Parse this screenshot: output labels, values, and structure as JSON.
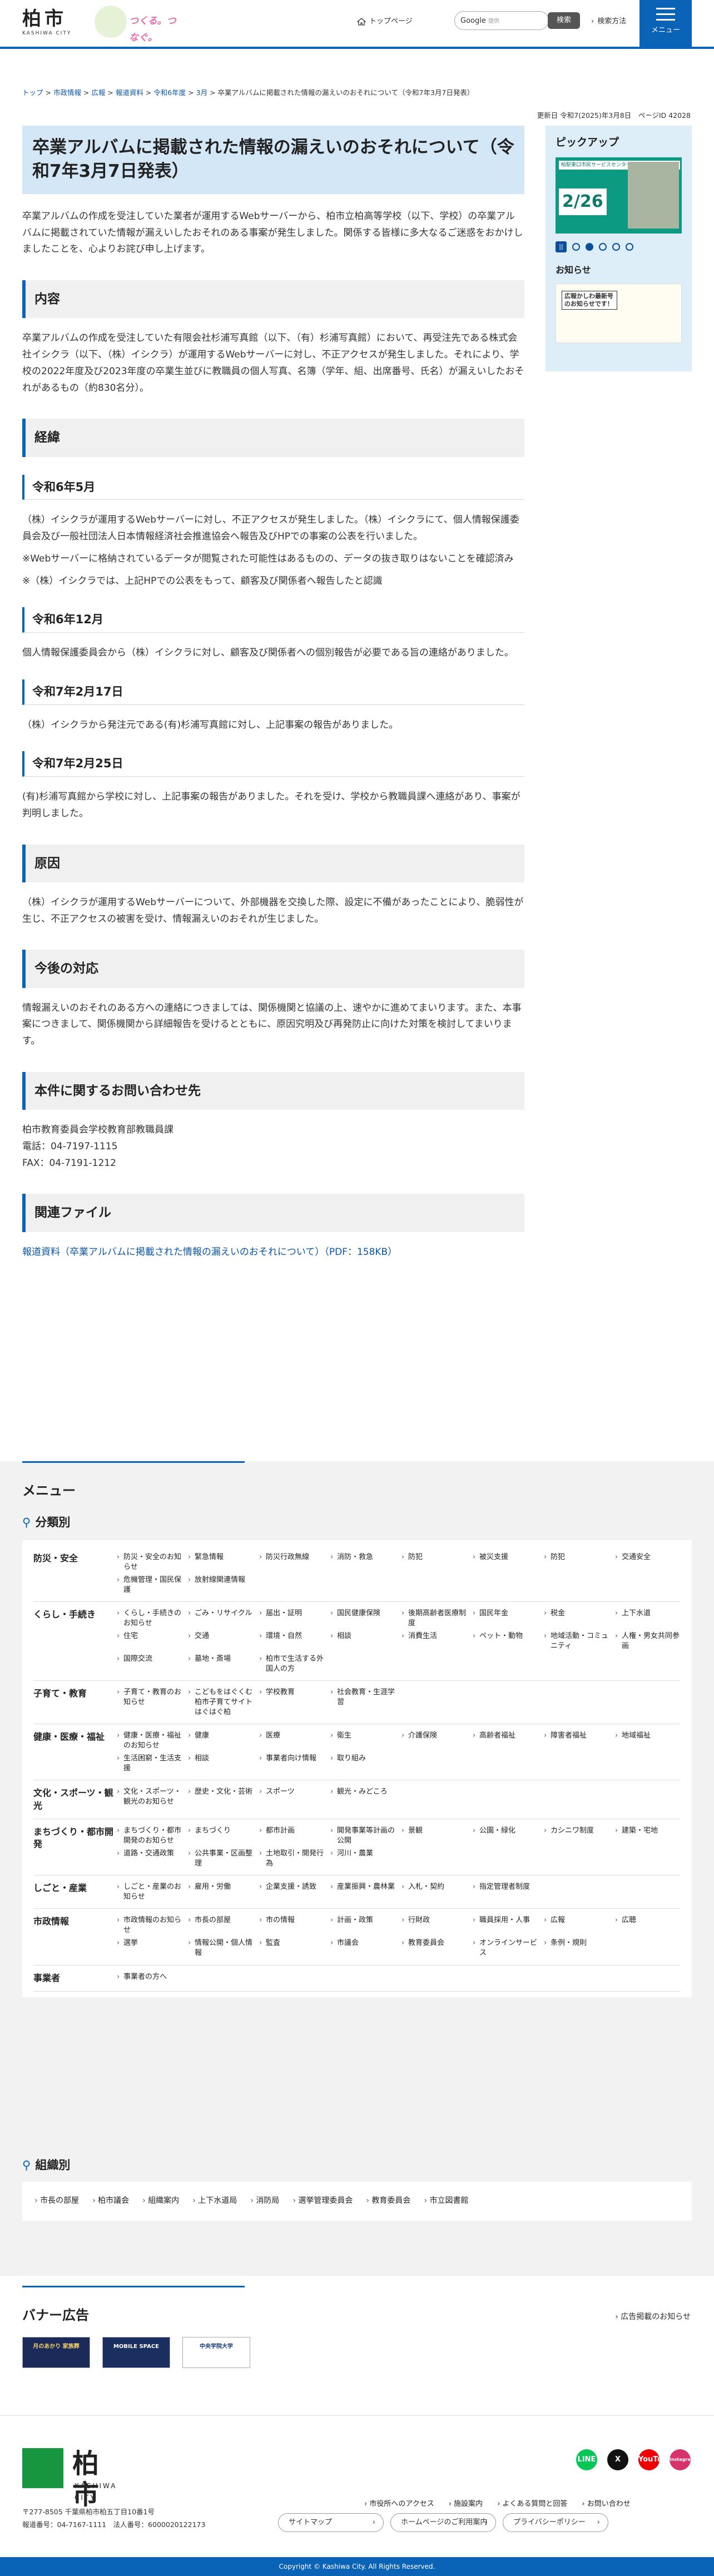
{
  "header": {
    "logo_jp": "柏市",
    "logo_en": "KASHIWA CITY",
    "mascot_tag": "つくる。つなぐ。",
    "top_page": "トップページ",
    "search_brand": "Google",
    "search_placeholder": "提供",
    "search_button": "検索",
    "search_method": "検索方法",
    "menu": "メニュー"
  },
  "breadcrumb": [
    "トップ",
    "市政情報",
    "広報",
    "報道資料",
    "令和6年度",
    "3月",
    "卒業アルバムに掲載された情報の漏えいのおそれについて（令和7年3月7日発表）"
  ],
  "meta": {
    "updated": "更新日 令和7(2025)年3月8日",
    "page_id": "ページID 42028"
  },
  "main": {
    "title": "卒業アルバムに掲載された情報の漏えいのおそれについて（令和7年3月7日発表）",
    "lead": "卒業アルバムの作成を受注していた業者が運用するWebサーバーから、柏市立柏高等学校（以下、学校）の卒業アルバムに掲載されていた情報が漏えいしたおそれのある事案が発生しました。関係する皆様に多大なるご迷惑をおかけしましたことを、心よりお詫び申し上げます。",
    "h_content": "内容",
    "content": "卒業アルバムの作成を受注していた有限会社杉浦写真館（以下、（有）杉浦写真館）において、再受注先である株式会社イシクラ（以下、（株）イシクラ）が運用するWebサーバーに対し、不正アクセスが発生しました。それにより、学校の2022年度及び2023年度の卒業生並びに教職員の個人写真、名簿（学年、組、出席番号、氏名）が漏えいしたおそれがあるもの（約830名分）。",
    "h_history": "経緯",
    "h_may": "令和6年5月",
    "may_p1": "（株）イシクラが運用するWebサーバーに対し、不正アクセスが発生しました。（株）イシクラにて、個人情報保護委員会及び一般社団法人日本情報経済社会推進協会へ報告及びHPでの事案の公表を行いました。",
    "may_p2": "※Webサーバーに格納されているデータが閲覧された可能性はあるものの、データの抜き取りはないことを確認済み",
    "may_p3": "※（株）イシクラでは、上記HPでの公表をもって、顧客及び関係者へ報告したと認識",
    "h_dec": "令和6年12月",
    "dec_p": "個人情報保護委員会から（株）イシクラに対し、顧客及び関係者への個別報告が必要である旨の連絡がありました。",
    "h_feb17": "令和7年2月17日",
    "feb17_p": "（株）イシクラから発注元である(有)杉浦写真館に対し、上記事案の報告がありました。",
    "h_feb25": "令和7年2月25日",
    "feb25_p": "(有)杉浦写真館から学校に対し、上記事案の報告がありました。それを受け、学校から教職員課へ連絡があり、事案が判明しました。",
    "h_cause": "原因",
    "cause_p": "（株）イシクラが運用するWebサーバーについて、外部機器を交換した際、設定に不備があったことにより、脆弱性が生じ、不正アクセスの被害を受け、情報漏えいのおそれが生じました。",
    "h_future": "今後の対応",
    "future_p": "情報漏えいのおそれのある方への連絡につきましては、関係機関と協議の上、速やかに進めてまいります。また、本事案につきまして、関係機関から詳細報告を受けるとともに、原因究明及び再発防止に向けた対策を検討してまいります。",
    "h_contact": "本件に関するお問い合わせ先",
    "contact_org": "柏市教育委員会学校教育部教職員課",
    "contact_tel": "電話：04-7197-1115",
    "contact_fax": "FAX：04-7191-1212",
    "h_files": "関連ファイル",
    "file_link": "報道資料（卒業アルバムに掲載された情報の漏えいのおそれについて）（PDF：158KB）"
  },
  "sidebar": {
    "pickup": "ピックアップ",
    "banner_text": "柏駅東口市民サービスセンター 臨時バス停センター",
    "banner_date": "2/26",
    "notice": "お知らせ",
    "notice_banner": "広報かしわ最新号のお知らせです！"
  },
  "menu": {
    "title": "メニュー",
    "by_category": "分類別",
    "categories": [
      {
        "head": "防災・安全",
        "items": [
          "防災・安全のお知らせ",
          "緊急情報",
          "防災行政無線",
          "消防・救急",
          "防犯",
          "被災支援",
          "防犯",
          "交通安全",
          "危機管理・国民保護",
          "放射線関連情報"
        ]
      },
      {
        "head": "くらし・手続き",
        "items": [
          "くらし・手続きのお知らせ",
          "ごみ・リサイクル",
          "届出・証明",
          "国民健康保険",
          "後期高齢者医療制度",
          "国民年金",
          "税金",
          "上下水道",
          "住宅",
          "交通",
          "環境・自然",
          "相談",
          "消費生活",
          "ペット・動物",
          "地域活動・コミュニティ",
          "人権・男女共同参画",
          "国際交流",
          "墓地・斎場",
          "柏市で生活する外国人の方"
        ]
      },
      {
        "head": "子育て・教育",
        "items": [
          "子育て・教育のお知らせ",
          "こどもをはぐくむ柏市子育てサイト　はぐはぐ柏",
          "学校教育",
          "社会教育・生涯学習"
        ]
      },
      {
        "head": "健康・医療・福祉",
        "items": [
          "健康・医療・福祉のお知らせ",
          "健康",
          "医療",
          "衛生",
          "介護保険",
          "高齢者福祉",
          "障害者福祉",
          "地域福祉",
          "生活困窮・生活支援",
          "相談",
          "事業者向け情報",
          "取り組み"
        ]
      },
      {
        "head": "文化・スポーツ・観光",
        "items": [
          "文化・スポーツ・観光のお知らせ",
          "歴史・文化・芸術",
          "スポーツ",
          "観光・みどころ"
        ]
      },
      {
        "head": "まちづくり・都市開発",
        "items": [
          "まちづくり・都市開発のお知らせ",
          "まちづくり",
          "都市計画",
          "開発事業等計画の公開",
          "景観",
          "公園・緑化",
          "カシニワ制度",
          "建築・宅地",
          "道路・交通政策",
          "公共事業・区画整理",
          "土地取引・開発行為",
          "河川・農業"
        ]
      },
      {
        "head": "しごと・産業",
        "items": [
          "しごと・産業のお知らせ",
          "雇用・労働",
          "企業支援・誘致",
          "産業振興・農林業",
          "入札・契約",
          "指定管理者制度"
        ]
      },
      {
        "head": "市政情報",
        "items": [
          "市政情報のお知らせ",
          "市長の部屋",
          "市の情報",
          "計画・政策",
          "行財政",
          "職員採用・人事",
          "広報",
          "広聴",
          "選挙",
          "情報公開・個人情報",
          "監査",
          "市議会",
          "教育委員会",
          "オンラインサービス",
          "条例・規則"
        ]
      },
      {
        "head": "事業者",
        "items": [
          "事業者の方へ"
        ]
      }
    ],
    "by_org": "組織別",
    "orgs": [
      "市長の部屋",
      "柏市議会",
      "組織案内",
      "上下水道局",
      "消防局",
      "選挙管理委員会",
      "教育委員会",
      "市立図書館"
    ]
  },
  "ads": {
    "title": "バナー広告",
    "about": "広告掲載のお知らせ",
    "banners": [
      "月のあかり 家族葬",
      "MOBILE SPACE",
      "中央学院大学"
    ]
  },
  "footer": {
    "logo_jp": "柏市",
    "logo_en": "KASHIWA CITY",
    "address": "〒277-8505 千葉県柏市柏五丁目10番1号",
    "phone": "報道番号：04-7167-1111　法人番号：6000020122173",
    "links1": [
      "市役所へのアクセス",
      "施設案内",
      "よくある質問と回答",
      "お問い合わせ"
    ],
    "links2": [
      "サイトマップ",
      "ホームページのご利用案内",
      "プライバシーポリシー"
    ],
    "social": [
      "LINE",
      "X",
      "YouTube",
      "Instagram"
    ],
    "copyright": "Copyright © Kashiwa City. All Rights Reserved."
  }
}
